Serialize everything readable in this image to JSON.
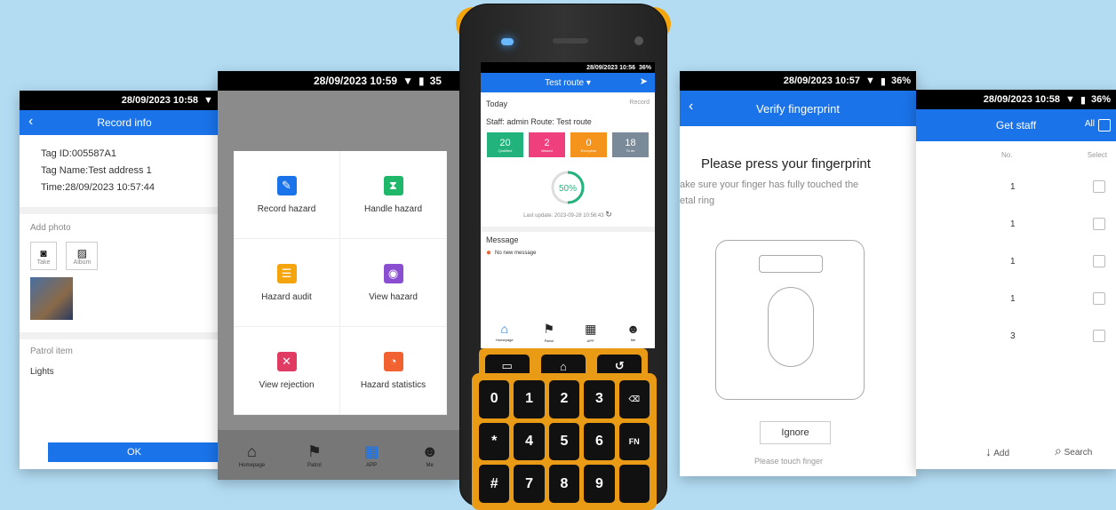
{
  "screen1": {
    "time": "28/09/2023  10:58",
    "title": "Record info",
    "tag_id": "Tag ID:005587A1",
    "tag_name": "Tag Name:Test address 1",
    "time_label": "Time:28/09/2023 10:57:44",
    "add_photo": "Add photo",
    "take": "Take",
    "album": "Album",
    "patrol_item": "Patrol item",
    "lights": "Lights",
    "ok": "OK"
  },
  "screen2": {
    "time": "28/09/2023  10:59",
    "battery": "35",
    "grid": [
      {
        "label": "Record hazard",
        "color": "#1a73e8",
        "icon": "✎"
      },
      {
        "label": "Handle hazard",
        "color": "#1fb86a",
        "icon": "⧗"
      },
      {
        "label": "Hazard audit",
        "color": "#f5a50c",
        "icon": "☰"
      },
      {
        "label": "View hazard",
        "color": "#8a4fd0",
        "icon": "◉"
      },
      {
        "label": "View rejection",
        "color": "#e03b62",
        "icon": "✕"
      },
      {
        "label": "Hazard statistics",
        "color": "#f26230",
        "icon": "◔"
      }
    ],
    "nav": [
      "Homepage",
      "Patrol",
      "APP",
      "Me"
    ]
  },
  "device": {
    "time": "28/09/2023 10:56",
    "battery": "36%",
    "route": "Test route ▾",
    "today": "Today",
    "record": "Record",
    "staff": "Staff: admin  Route: Test route",
    "stats": [
      {
        "value": "20",
        "label": "Qualified",
        "color": "#22b27c"
      },
      {
        "value": "2",
        "label": "Missed",
        "color": "#ef3f7c"
      },
      {
        "value": "0",
        "label": "Exception",
        "color": "#f5941c"
      },
      {
        "value": "18",
        "label": "To do",
        "color": "#7a8a99"
      }
    ],
    "percent": "50%",
    "progress": 0.5,
    "updated": "Last update: 2023-09-28 10:56:43",
    "message": "Message",
    "no_message": "No new message",
    "nav": [
      "Homepage",
      "Patrol",
      "APP",
      "Me"
    ],
    "keys": [
      "0",
      "1",
      "2",
      "3",
      "*",
      "4",
      "5",
      "6",
      "#",
      "7",
      "8",
      "9"
    ],
    "del": "⌫",
    "fn": "FN"
  },
  "screen4": {
    "time": "28/09/2023  10:57",
    "battery": "36%",
    "title": "Verify fingerprint",
    "heading": "Please press your fingerprint",
    "subtext1": "ake sure your finger has fully touched the",
    "subtext2": "etal ring",
    "ignore": "Ignore",
    "touch": "Please touch finger"
  },
  "screen5": {
    "time": "28/09/2023  10:58",
    "battery": "36%",
    "title": "Get staff",
    "all": "All",
    "col_no": "No.",
    "col_select": "Select",
    "rows": [
      "1",
      "1",
      "1",
      "1",
      "3"
    ],
    "add": "Add",
    "search": "Search"
  }
}
